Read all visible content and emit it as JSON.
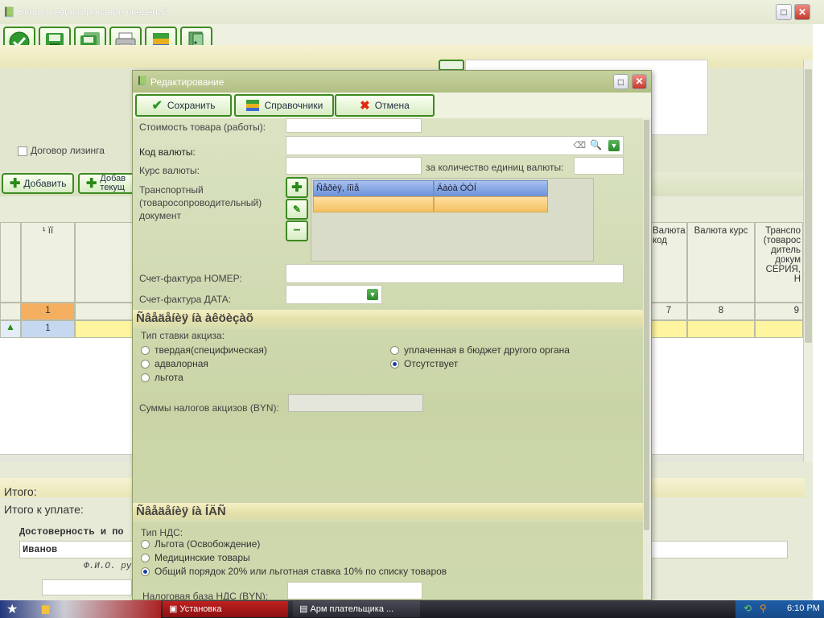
{
  "main_window": {
    "title": "Ввод и редактирование сведений",
    "leasing_label": "Договор лизинга",
    "add_button": "Добавить",
    "add_current_button": "Добав текущ",
    "grid": {
      "col_header_1": "¹ ïï",
      "col_valuta_kod": "Валюта код",
      "col_valuta_kurs": "Валюта курс",
      "col_transport": "Транспо (товарос дитель докум СЕРИЯ, Н",
      "row_num_1": "1",
      "num_7": "7",
      "num_8": "8",
      "num_9": "9",
      "row_num_2": "1"
    },
    "itogo": "Итого:",
    "itogo_k_uplate": "Итого к уплате:",
    "dostovernost": "Достоверность и по",
    "signer_name": "Иванов",
    "fio_caption": "Ф.И.О. рук"
  },
  "dialog": {
    "title": "Редактирование",
    "save_button": "Сохранить",
    "refs_button": "Справочники",
    "cancel_button": "Отмена",
    "cost_label": "Стоимость товара (работы):",
    "currency_code_label": "Код валюты:",
    "rate_label": "Курс валюты:",
    "per_units_label": "за количество единиц валюты:",
    "transport_doc_label": "Транспортный (товаросопроводительный) документ",
    "table_col1": "Ñåðèÿ, íîìå",
    "table_col2": "Äàòà ÒÒÍ",
    "invoice_number_label": "Счет-фактура НОМЕР:",
    "invoice_date_label": "Счет-фактура ДАТА:",
    "excise_section": "Ñâåäåíèÿ íà àêöèçàõ",
    "excise_type_label": "Тип ставки акциза:",
    "excise_options": [
      "твердая(специфическая)",
      "адвалорная",
      "льгота",
      "уплаченная в бюджет другого органа",
      "Отсутствует"
    ],
    "excise_sum_label": "Суммы налогов акцизов (BYN):",
    "vat_section": "Ñâåäåíèÿ íà ÍÄÑ",
    "vat_type_label": "Тип НДС:",
    "vat_options": [
      "Льгота (Освобождение)",
      "Медицинские товары",
      "Общий порядок 20% или льготная ставка 10% по списку товаров"
    ],
    "vat_base_label": "Налоговая база НДС (BYN):"
  },
  "taskbar": {
    "task1": "Установка",
    "task2": "Арм плательщика ...",
    "clock": "6:10 PM"
  },
  "colors": {
    "accent_green": "#3c8a22",
    "selected_row": "#fff4a0",
    "header_blue": "#7aa0e0",
    "orange_row": "#ffc870"
  }
}
